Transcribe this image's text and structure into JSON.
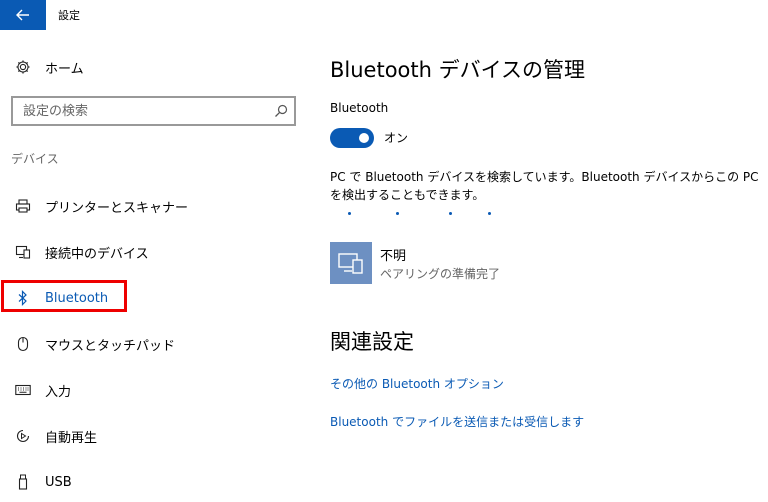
{
  "window": {
    "title": "設定"
  },
  "sidebar": {
    "home_label": "ホーム",
    "search_placeholder": "設定の検索",
    "section_heading": "デバイス",
    "items": [
      {
        "label": "プリンターとスキャナー",
        "icon": "printer-icon"
      },
      {
        "label": "接続中のデバイス",
        "icon": "connected-devices-icon"
      },
      {
        "label": "Bluetooth",
        "icon": "bluetooth-icon",
        "active": true
      },
      {
        "label": "マウスとタッチパッド",
        "icon": "mouse-icon"
      },
      {
        "label": "入力",
        "icon": "keyboard-icon"
      },
      {
        "label": "自動再生",
        "icon": "autoplay-icon"
      },
      {
        "label": "USB",
        "icon": "usb-icon"
      }
    ]
  },
  "main": {
    "title": "Bluetooth デバイスの管理",
    "bluetooth_label": "Bluetooth",
    "toggle_state": "オン",
    "description": "PC で Bluetooth デバイスを検索しています。Bluetooth デバイスからこの PC を検出することもできます。",
    "device": {
      "name": "不明",
      "status": "ペアリングの準備完了"
    },
    "related_title": "関連設定",
    "links": [
      "その他の Bluetooth オプション",
      "Bluetooth でファイルを送信または受信します"
    ]
  },
  "colors": {
    "accent": "#0a5ab4",
    "highlight": "#ee0000",
    "device_tile": "#6d90c2"
  }
}
